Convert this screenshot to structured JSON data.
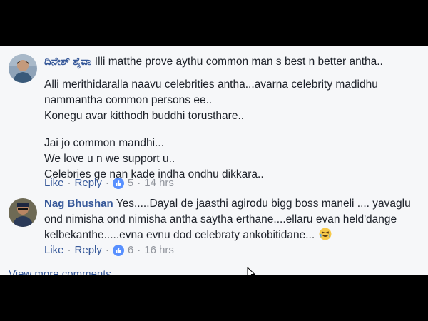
{
  "comments": [
    {
      "author": "ದಿನೇಶ್ ಶೈವಾ",
      "first_line": "Illi matthe prove aythu common man s best n better antha..",
      "lines": [
        "Alli merithidaralla naavu celebrities antha...avarna celebrity madidhu",
        "nammantha common persons ee..",
        "Konegu avar kitthodh buddhi torusthare..",
        "",
        "Jai jo common mandhi...",
        "We love u n we support u..",
        "Celebries ge nan kade indha ondhu dikkara.."
      ],
      "like_label": "Like",
      "reply_label": "Reply",
      "reaction_count": "5",
      "time": "14 hrs",
      "avatar_icon": "profile-photo"
    },
    {
      "author": "Nag Bhushan",
      "text_line1": "Yes.....Dayal de jaasthi agirodu bigg boss maneli .... yavaglu",
      "text_line2": "ond nimisha ond nimisha antha saytha erthane....ellaru evan held'dange",
      "text_line3": "kelbekanthe.....evna evnu dod celebraty ankobitidane...",
      "emoji": "laughing-emoji",
      "like_label": "Like",
      "reply_label": "Reply",
      "reaction_count": "6",
      "time": "16 hrs",
      "avatar_icon": "profile-photo"
    }
  ],
  "view_more": "View more comments",
  "colors": {
    "link": "#365899",
    "text": "#1d2129",
    "meta": "#90949c",
    "like_blue": "#5890ff",
    "panel_bg": "#f6f7f9"
  }
}
